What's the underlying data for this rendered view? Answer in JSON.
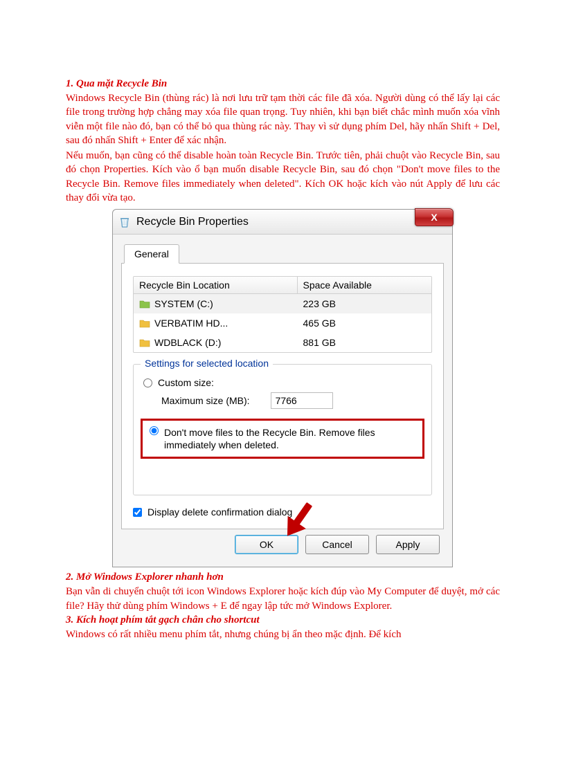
{
  "section1": {
    "heading": "1. Qua mặt Recycle Bin",
    "p1": "Windows Recycle Bin (thùng rác) là nơi lưu trữ tạm thời các file đã xóa. Người dùng có thể lấy lại các file trong trường hợp chẳng may xóa file quan trọng. Tuy nhiên, khi bạn biết chắc mình muốn xóa vĩnh viễn một file nào đó, bạn có thể bỏ qua thùng rác này. Thay vì sử dụng phím Del, hãy nhấn Shift + Del, sau đó nhấn Shift + Enter để xác nhận.",
    "p2": "Nếu muốn, bạn cũng có thể disable hoàn toàn Recycle Bin. Trước tiên, phải chuột vào Recycle Bin, sau đó chọn Properties. Kích vào ổ bạn muốn disable Recycle Bin, sau đó chọn \"Don't move files to the Recycle Bin. Remove files immediately when deleted\". Kích OK hoặc kích vào nút Apply để lưu các thay đổi vừa tạo."
  },
  "dialog": {
    "title": "Recycle Bin Properties",
    "close": "X",
    "tab": "General",
    "table": {
      "col1": "Recycle Bin Location",
      "col2": "Space Available",
      "rows": [
        {
          "name": "SYSTEM (C:)",
          "space": "223 GB",
          "color": "#8bc34a"
        },
        {
          "name": "VERBATIM HD...",
          "space": "465 GB",
          "color": "#f0c040"
        },
        {
          "name": "WDBLACK (D:)",
          "space": "881 GB",
          "color": "#f0c040"
        }
      ]
    },
    "group": {
      "title": "Settings for selected location",
      "custom": "Custom size:",
      "maxlabel": "Maximum size (MB):",
      "maxvalue": "7766",
      "dontmove": "Don't move files to the Recycle Bin. Remove files immediately when deleted."
    },
    "confirm": "Display delete confirmation dialog",
    "buttons": {
      "ok": "OK",
      "cancel": "Cancel",
      "apply": "Apply"
    }
  },
  "section2": {
    "heading": "2. Mở Windows Explorer nhanh hơn",
    "p1": "Bạn vẫn di chuyển chuột tới icon Windows Explorer hoặc kích đúp vào My Computer để duyệt, mở các file? Hãy thử dùng phím Windows + E để ngay lập tức mở Windows Explorer."
  },
  "section3": {
    "heading": "3. Kích hoạt phím tắt gạch chân cho shortcut",
    "p1": "Windows có rất nhiều menu phím tắt, nhưng chúng bị ẩn theo mặc định. Để kích"
  }
}
